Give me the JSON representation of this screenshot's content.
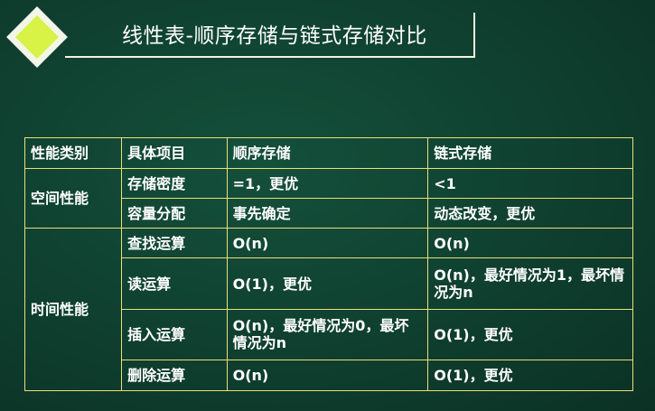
{
  "title": "线性表-顺序存储与链式存储对比",
  "table": {
    "headers": [
      "性能类别",
      "具体项目",
      "顺序存储",
      "链式存储"
    ],
    "groups": [
      {
        "category": "空间性能",
        "rows": [
          {
            "item": "存储密度",
            "seq": "=1，更优",
            "link": "<1"
          },
          {
            "item": "容量分配",
            "seq": "事先确定",
            "link": "动态改变，更优"
          }
        ]
      },
      {
        "category": "时间性能",
        "rows": [
          {
            "item": "查找运算",
            "seq": "O(n)",
            "link": "O(n)"
          },
          {
            "item": "读运算",
            "seq": "O(1)，更优",
            "link": "O(n)，最好情况为1，最坏情况为n"
          },
          {
            "item": "插入运算",
            "seq": "O(n)，最好情况为0，最坏情况为n",
            "link": "O(1)，更优"
          },
          {
            "item": "删除运算",
            "seq": "O(n)",
            "link": "O(1)，更优"
          }
        ]
      }
    ]
  },
  "colors": {
    "background": "#0f3f2f",
    "border": "#e8e07a",
    "diamond": "#d8f246",
    "text": "#ffffff"
  }
}
